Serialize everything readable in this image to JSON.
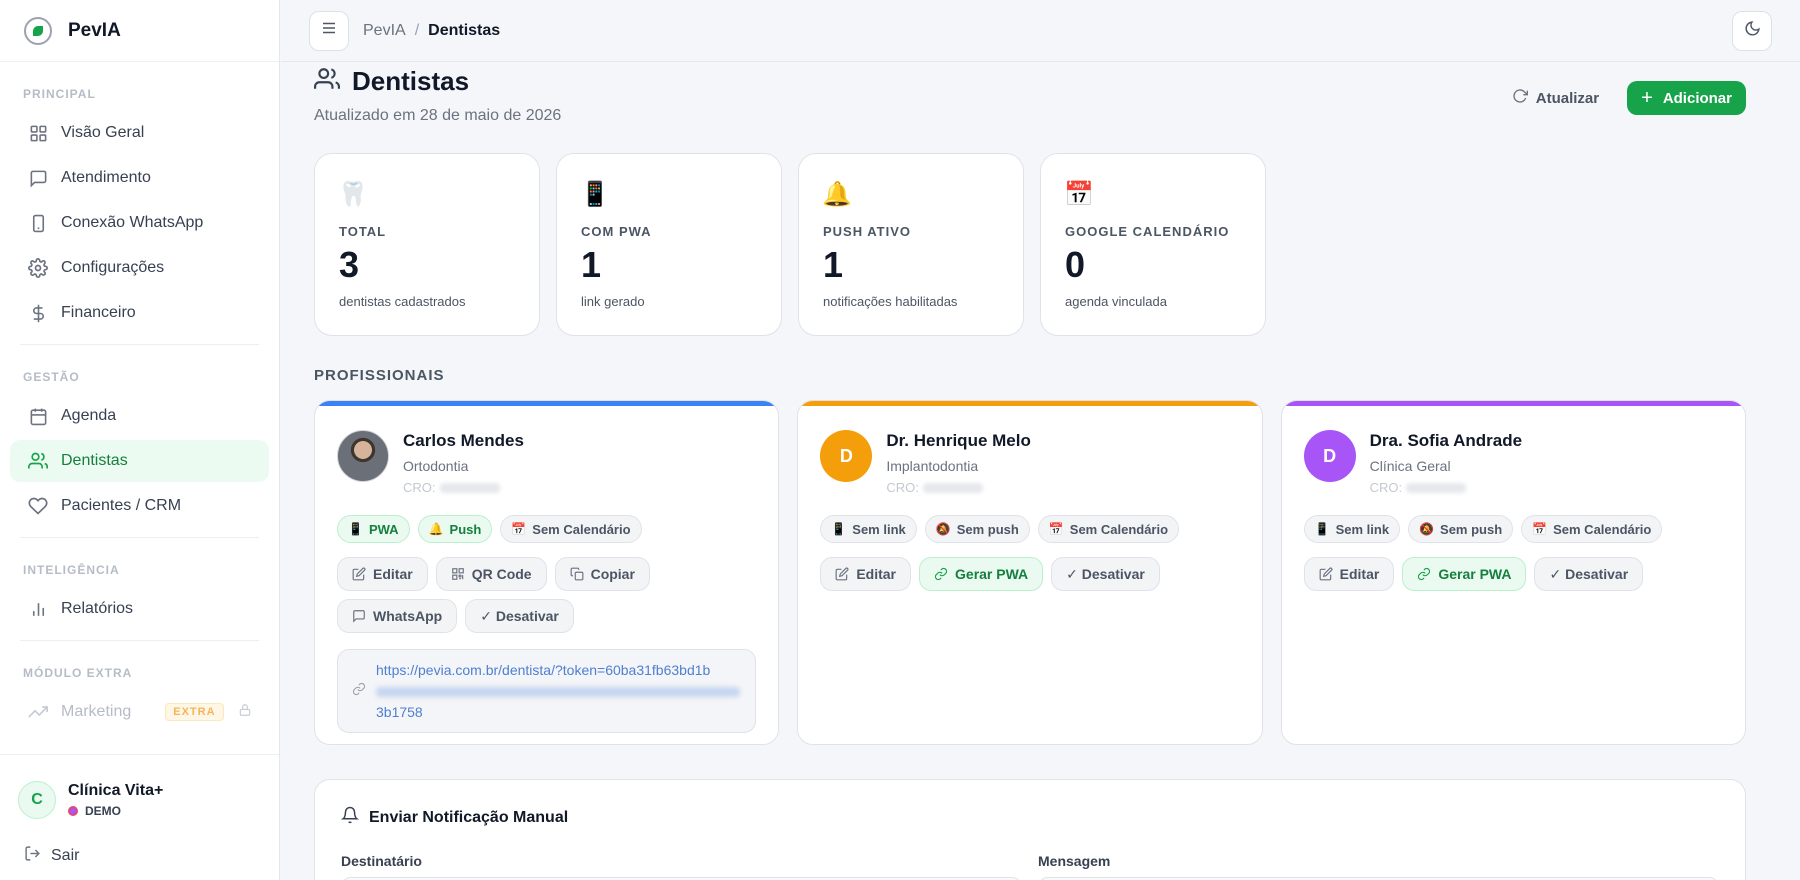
{
  "app": {
    "name": "PevIA"
  },
  "sidebar": {
    "sections": [
      {
        "title": "PRINCIPAL",
        "items": [
          {
            "label": "Visão Geral",
            "icon": "grid-icon"
          },
          {
            "label": "Atendimento",
            "icon": "chat-icon"
          },
          {
            "label": "Conexão WhatsApp",
            "icon": "phone-icon"
          },
          {
            "label": "Configurações",
            "icon": "gear-icon"
          },
          {
            "label": "Financeiro",
            "icon": "dollar-icon"
          }
        ]
      },
      {
        "title": "GESTÃO",
        "items": [
          {
            "label": "Agenda",
            "icon": "calendar-icon"
          },
          {
            "label": "Dentistas",
            "icon": "users-icon",
            "active": true
          },
          {
            "label": "Pacientes / CRM",
            "icon": "heart-icon"
          }
        ]
      },
      {
        "title": "INTELIGÊNCIA",
        "items": [
          {
            "label": "Relatórios",
            "icon": "bar-chart-icon"
          }
        ]
      },
      {
        "title": "MÓDULO EXTRA",
        "items": [
          {
            "label": "Marketing",
            "icon": "trend-icon",
            "badge": "EXTRA",
            "locked": true
          }
        ]
      }
    ],
    "user": {
      "initial": "C",
      "name": "Clínica Vita+",
      "plan": "DEMO"
    },
    "logout": "Sair"
  },
  "topbar": {
    "breadcrumb": [
      "PevIA",
      "Dentistas"
    ]
  },
  "page": {
    "title": "Dentistas",
    "subtitle": "Atualizado em 28 de maio de 2026",
    "refresh_label": "Atualizar",
    "add_label": "Adicionar"
  },
  "stats": [
    {
      "icon": "🦷",
      "label": "TOTAL",
      "value": "3",
      "desc": "dentistas cadastrados"
    },
    {
      "icon": "📱",
      "label": "COM PWA",
      "value": "1",
      "desc": "link gerado"
    },
    {
      "icon": "🔔",
      "label": "PUSH ATIVO",
      "value": "1",
      "desc": "notificações habilitadas"
    },
    {
      "icon": "📅",
      "label": "GOOGLE CALENDÁRIO",
      "value": "0",
      "desc": "agenda vinculada"
    }
  ],
  "section_title": "PROFISSIONAIS",
  "professionals": [
    {
      "name": "Carlos Mendes",
      "specialty": "Ortodontia",
      "cro_label": "CRO:",
      "accent": "#3b82f6",
      "badges": [
        {
          "icon": "📱",
          "label": "PWA"
        },
        {
          "icon": "🔔",
          "label": "Push"
        },
        {
          "icon": "📅",
          "label": "Sem Calendário"
        }
      ],
      "actions": [
        "Editar",
        "QR Code",
        "Copiar",
        "WhatsApp",
        "✓ Desativar"
      ],
      "link_start": "https://pevia.com.br/dentista/?token=60ba31fb63bd1b",
      "link_end": "3b1758"
    },
    {
      "initial": "D",
      "name": "Dr. Henrique Melo",
      "specialty": "Implantodontia",
      "cro_label": "CRO:",
      "accent": "#f59e0b",
      "badges": [
        {
          "icon": "📱",
          "label": "Sem link"
        },
        {
          "icon": "🔕",
          "label": "Sem push"
        },
        {
          "icon": "📅",
          "label": "Sem Calendário"
        }
      ],
      "actions": [
        "Editar",
        "Gerar PWA",
        "✓ Desativar"
      ]
    },
    {
      "initial": "D",
      "name": "Dra. Sofia Andrade",
      "specialty": "Clínica Geral",
      "cro_label": "CRO:",
      "accent": "#a855f7",
      "badges": [
        {
          "icon": "📱",
          "label": "Sem link"
        },
        {
          "icon": "🔕",
          "label": "Sem push"
        },
        {
          "icon": "📅",
          "label": "Sem Calendário"
        }
      ],
      "actions": [
        "Editar",
        "Gerar PWA",
        "✓ Desativar"
      ]
    }
  ],
  "notify": {
    "title": "Enviar Notificação Manual",
    "recipient_label": "Destinatário",
    "message_label": "Mensagem"
  }
}
